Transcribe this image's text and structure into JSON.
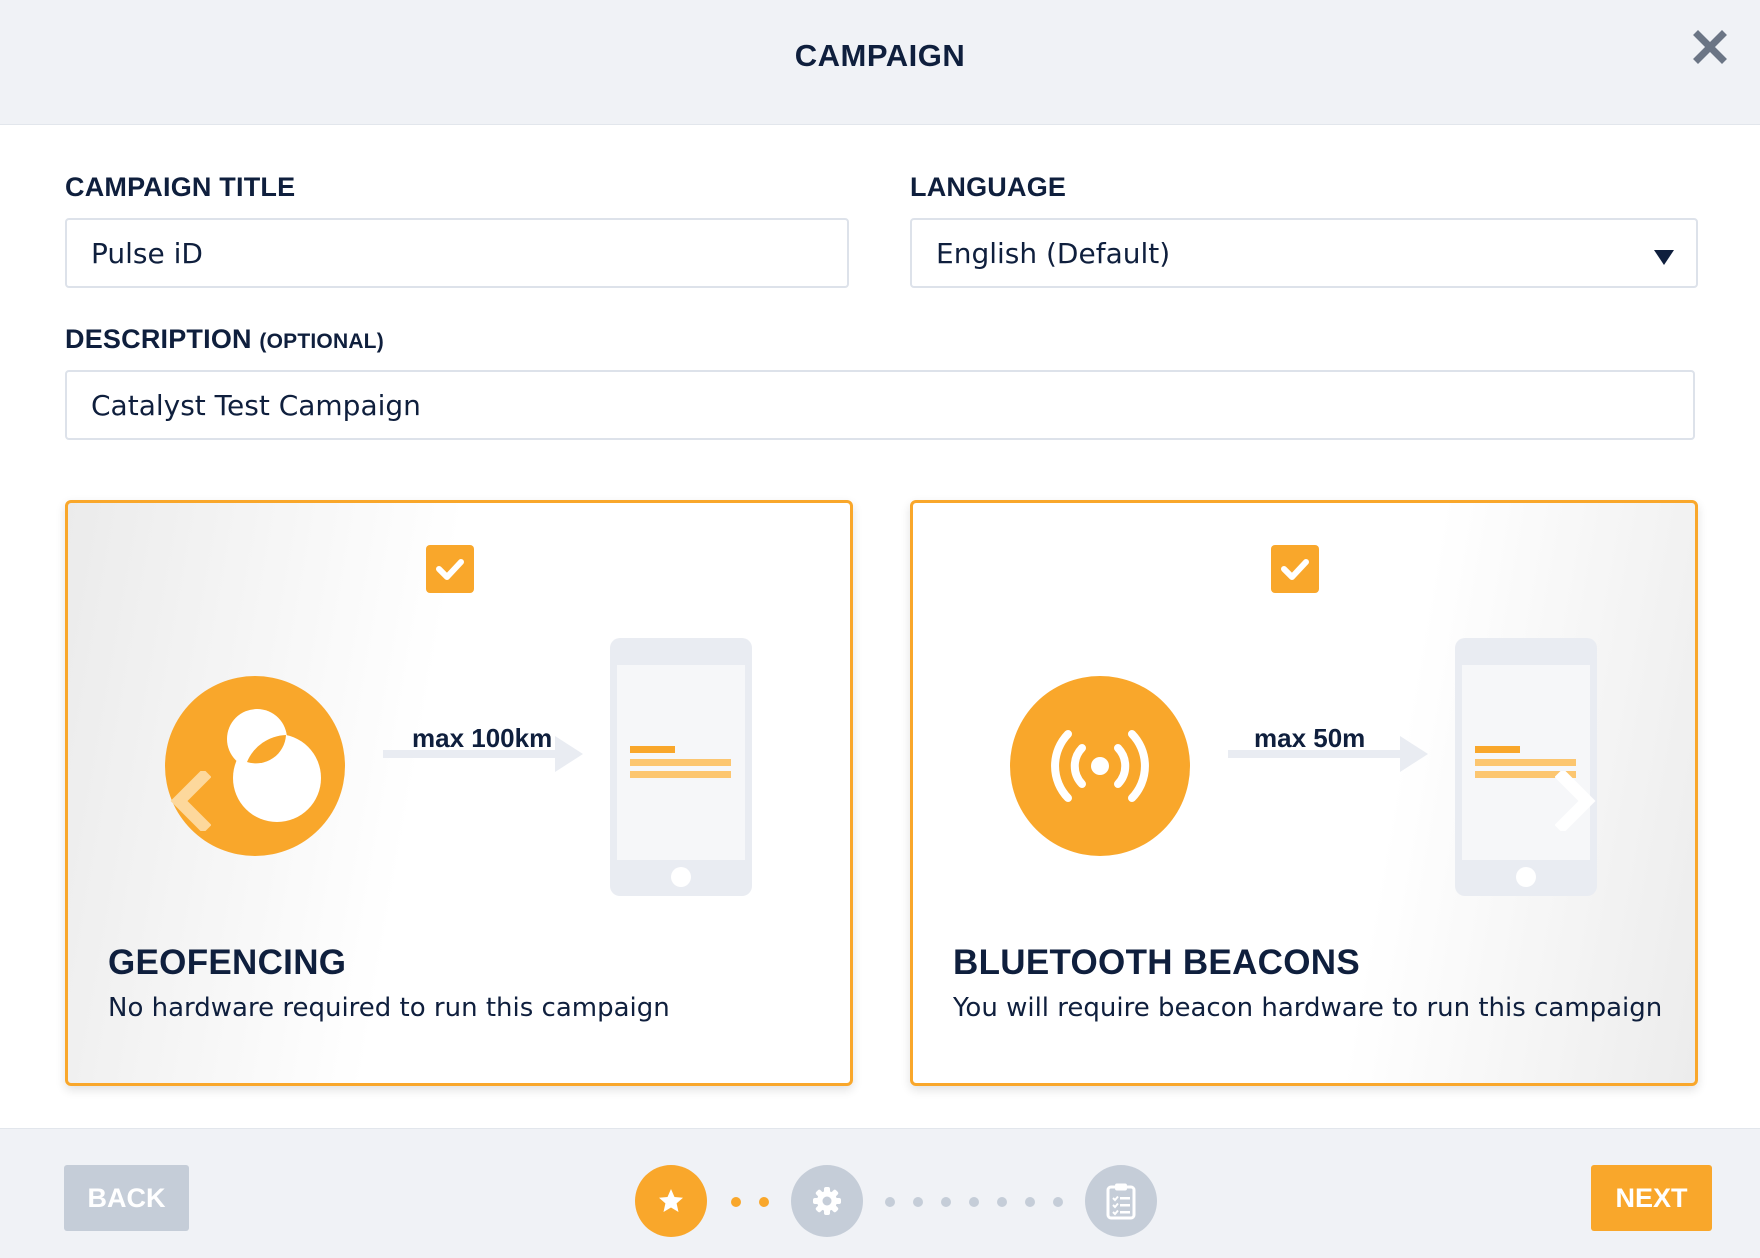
{
  "header": {
    "title": "CAMPAIGN"
  },
  "form": {
    "campaign_title_label": "CAMPAIGN TITLE",
    "campaign_title_value": "Pulse iD",
    "language_label": "LANGUAGE",
    "language_value": "English (Default)",
    "description_label": "DESCRIPTION",
    "description_optional": "(OPTIONAL)",
    "description_value": "Catalyst Test Campaign"
  },
  "cards": [
    {
      "title": "GEOFENCING",
      "description": "No hardware required to run this campaign",
      "range": "max 100km",
      "icon": "geofence-icon",
      "checked": true
    },
    {
      "title": "BLUETOOTH BEACONS",
      "description": "You will require beacon hardware to run this campaign",
      "range": "max 50m",
      "icon": "beacon-signal-icon",
      "checked": true
    }
  ],
  "footer": {
    "back_label": "BACK",
    "next_label": "NEXT",
    "steps": [
      {
        "icon": "star-icon",
        "active": true
      },
      {
        "icon": "gear-icon",
        "active": false
      },
      {
        "icon": "clipboard-icon",
        "active": false
      }
    ]
  },
  "colors": {
    "accent": "#f9a72b",
    "text_dark": "#0f1f3d",
    "muted": "#c5cdd8",
    "header_bg": "#f0f2f6"
  }
}
